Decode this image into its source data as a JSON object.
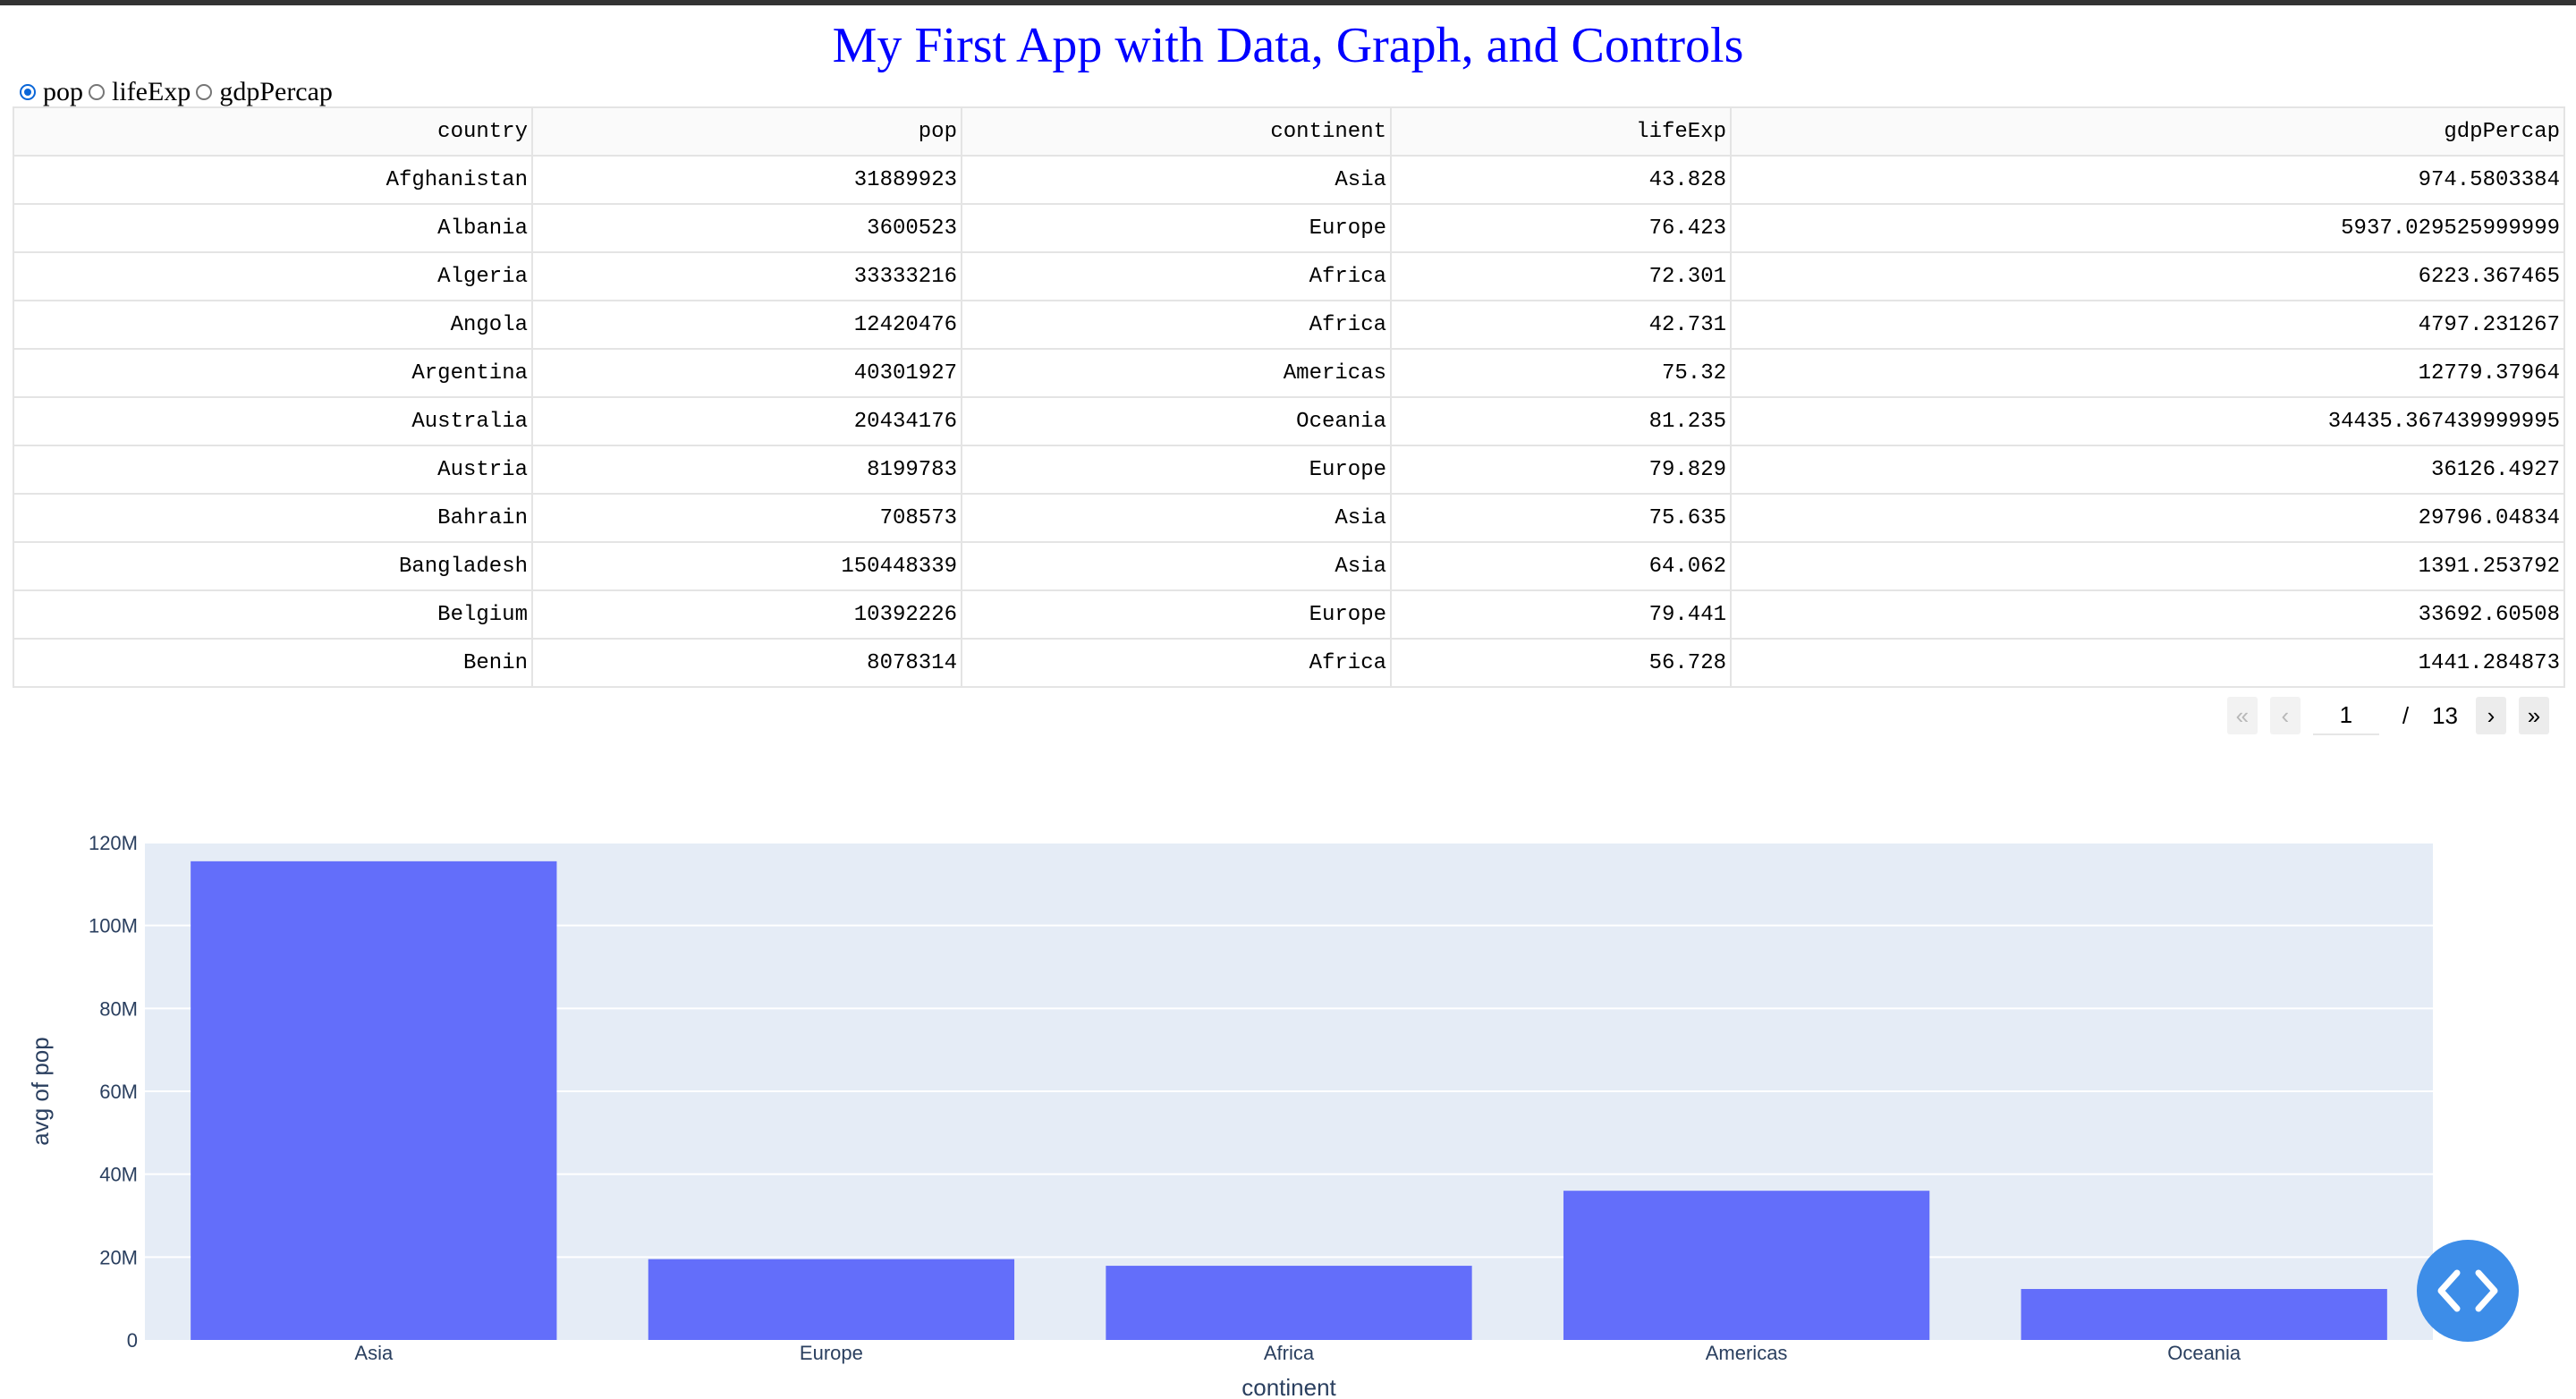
{
  "app": {
    "title": "My First App with Data, Graph, and Controls"
  },
  "controls": {
    "radio_options": [
      {
        "label": "pop",
        "checked": true
      },
      {
        "label": "lifeExp",
        "checked": false
      },
      {
        "label": "gdpPercap",
        "checked": false
      }
    ]
  },
  "table": {
    "columns": [
      "country",
      "pop",
      "continent",
      "lifeExp",
      "gdpPercap"
    ],
    "rows": [
      [
        "Afghanistan",
        "31889923",
        "Asia",
        "43.828",
        "974.5803384"
      ],
      [
        "Albania",
        "3600523",
        "Europe",
        "76.423",
        "5937.029525999999"
      ],
      [
        "Algeria",
        "33333216",
        "Africa",
        "72.301",
        "6223.367465"
      ],
      [
        "Angola",
        "12420476",
        "Africa",
        "42.731",
        "4797.231267"
      ],
      [
        "Argentina",
        "40301927",
        "Americas",
        "75.32",
        "12779.37964"
      ],
      [
        "Australia",
        "20434176",
        "Oceania",
        "81.235",
        "34435.367439999995"
      ],
      [
        "Austria",
        "8199783",
        "Europe",
        "79.829",
        "36126.4927"
      ],
      [
        "Bahrain",
        "708573",
        "Asia",
        "75.635",
        "29796.04834"
      ],
      [
        "Bangladesh",
        "150448339",
        "Asia",
        "64.062",
        "1391.253792"
      ],
      [
        "Belgium",
        "10392226",
        "Europe",
        "79.441",
        "33692.60508"
      ],
      [
        "Benin",
        "8078314",
        "Africa",
        "56.728",
        "1441.284873"
      ]
    ]
  },
  "pagination": {
    "first_icon": "«",
    "prev_icon": "‹",
    "next_icon": "›",
    "last_icon": "»",
    "current_page": "1",
    "separator": "/",
    "total_pages": "13"
  },
  "chart_data": {
    "type": "bar",
    "categories": [
      "Asia",
      "Europe",
      "Africa",
      "Americas",
      "Oceania"
    ],
    "values": [
      115500000,
      19500000,
      17900000,
      36000000,
      12300000
    ],
    "xlabel": "continent",
    "ylabel": "avg of pop",
    "ylim": [
      0,
      120000000
    ],
    "yticks": [
      0,
      20000000,
      40000000,
      60000000,
      80000000,
      100000000,
      120000000
    ],
    "ytick_labels": [
      "0",
      "20M",
      "40M",
      "60M",
      "80M",
      "100M",
      "120M"
    ],
    "grid": true,
    "bar_color": "#636efa",
    "plot_bg": "#e5ecf6"
  },
  "colors": {
    "title": "#0000ff",
    "fab": "#3d8de8"
  },
  "fab": {
    "icon": "code-brackets-icon"
  }
}
